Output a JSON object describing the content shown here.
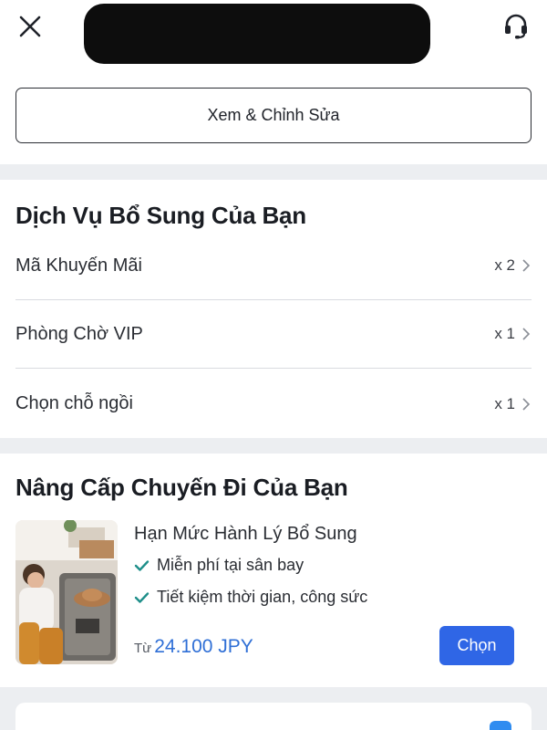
{
  "header": {
    "edit_button_label": "Xem & Chỉnh Sửa"
  },
  "services": {
    "title": "Dịch Vụ Bổ Sung Của Bạn",
    "items": [
      {
        "label": "Mã Khuyến Mãi",
        "count": "x 2"
      },
      {
        "label": "Phòng Chờ VIP",
        "count": "x 1"
      },
      {
        "label": "Chọn chỗ ngồi",
        "count": "x 1"
      }
    ]
  },
  "upgrade": {
    "title": "Nâng Cấp Chuyến Đi Của Bạn",
    "offer": {
      "title": "Hạn Mức Hành Lý Bổ Sung",
      "benefits": [
        "Miễn phí tại sân bay",
        "Tiết kiệm thời gian, công sức"
      ],
      "price_prefix": "Từ",
      "price": "24.100 JPY",
      "select_label": "Chọn"
    }
  },
  "colors": {
    "accent": "#2f66e6",
    "price": "#2f6fd6",
    "check": "#1f8f8a"
  },
  "icons": [
    "close-icon",
    "headset-icon",
    "chevron-right-icon",
    "check-icon"
  ]
}
